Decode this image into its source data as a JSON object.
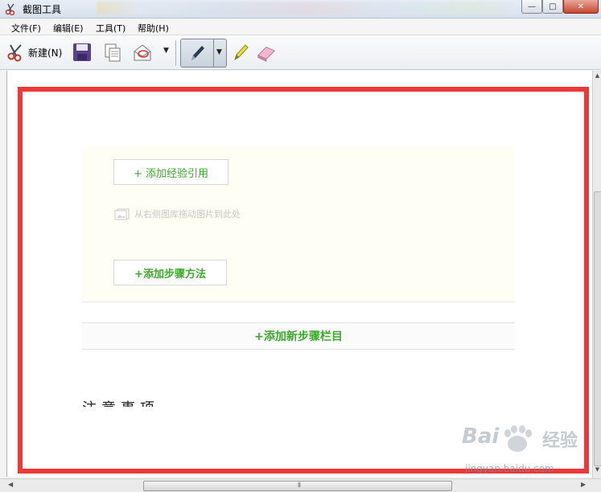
{
  "window": {
    "title": "截图工具",
    "controls": {
      "minimize": "—",
      "maximize": "□",
      "close": "✕"
    }
  },
  "menu": {
    "items": [
      "文件(F)",
      "编辑(E)",
      "工具(T)",
      "帮助(H)"
    ]
  },
  "toolbar": {
    "new_label": "新建(N)",
    "icons": [
      "scissors-icon",
      "save-icon",
      "copy-icon",
      "email-icon",
      "dropdown-arrow-icon",
      "pen-icon",
      "highlighter-icon",
      "eraser-icon"
    ]
  },
  "content": {
    "add_reference": "+ 添加经验引用",
    "image_hint": "从右侧图库拖动图片到此处",
    "add_step": "+添加步骤方法",
    "add_section": "+添加新步骤栏目",
    "partial_heading": "注意事项"
  },
  "watermark": {
    "logo": "Bai",
    "logo_cn": "经验",
    "url": "jingyan.baidu.com"
  },
  "colors": {
    "selection_border": "#ee3737",
    "accent_green": "#3aaa2a",
    "panel_bg": "#fefef4"
  }
}
